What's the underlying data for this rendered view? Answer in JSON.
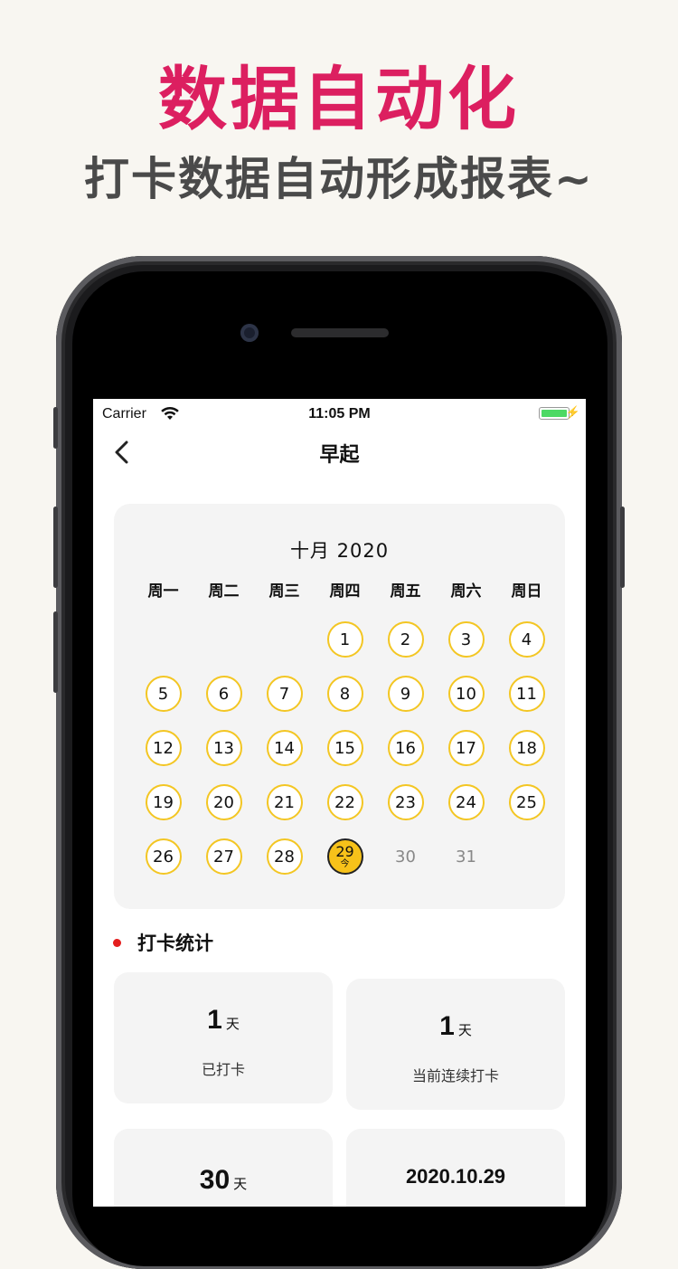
{
  "promo": {
    "title": "数据自动化",
    "subtitle": "打卡数据自动形成报表~"
  },
  "status_bar": {
    "carrier": "Carrier",
    "time": "11:05 PM",
    "battery_icon": "battery-charging-icon"
  },
  "nav": {
    "title": "早起",
    "back_icon": "chevron-left-icon"
  },
  "calendar": {
    "month_label": "十月 2020",
    "weekdays": [
      "周一",
      "周二",
      "周三",
      "周四",
      "周五",
      "周六",
      "周日"
    ],
    "today_tag": "今",
    "checked_color": "#f3c623",
    "today_color": "#f7c21a",
    "weeks": [
      [
        "",
        "",
        "",
        "1",
        "2",
        "3",
        "4"
      ],
      [
        "5",
        "6",
        "7",
        "8",
        "9",
        "10",
        "11"
      ],
      [
        "12",
        "13",
        "14",
        "15",
        "16",
        "17",
        "18"
      ],
      [
        "19",
        "20",
        "21",
        "22",
        "23",
        "24",
        "25"
      ],
      [
        "26",
        "27",
        "28",
        "29",
        "30",
        "31",
        ""
      ]
    ],
    "today": "29",
    "unchecked_days": [
      "30",
      "31"
    ]
  },
  "stats": {
    "section_title": "打卡统计",
    "dot_color": "#e41e1e",
    "cards": [
      {
        "value": "1",
        "unit": "天",
        "label": "已打卡"
      },
      {
        "value": "1",
        "unit": "天",
        "label": "当前连续打卡"
      },
      {
        "value": "30",
        "unit": "天",
        "label": ""
      },
      {
        "value": "2020.10.29",
        "unit": "",
        "label": ""
      }
    ]
  }
}
